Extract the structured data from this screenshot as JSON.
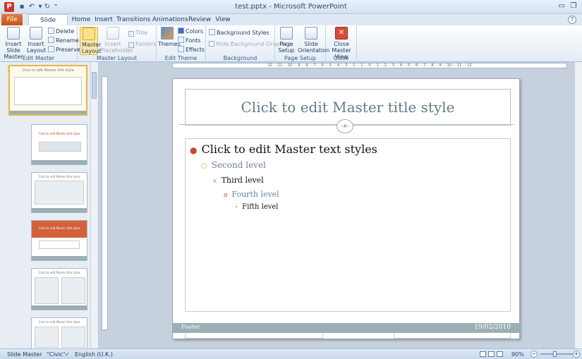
{
  "window": {
    "title": "test.pptx - Microsoft PowerPoint",
    "app_icon_letter": "P",
    "help": "?"
  },
  "tabs": {
    "file": "File",
    "slide_master": "Slide Master",
    "home": "Home",
    "insert": "Insert",
    "transitions": "Transitions",
    "animations": "Animations",
    "review": "Review",
    "view": "View"
  },
  "ribbon": {
    "edit_master": {
      "label": "Edit Master",
      "insert_slide_master": "Insert Slide Master",
      "insert_layout": "Insert Layout",
      "delete": "Delete",
      "rename": "Rename",
      "preserve": "Preserve"
    },
    "master_layout": {
      "label": "Master Layout",
      "master_layout_btn": "Master Layout",
      "insert_placeholder": "Insert Placeholder",
      "title": "Title",
      "footers": "Footers"
    },
    "edit_theme": {
      "label": "Edit Theme",
      "themes": "Themes",
      "colors": "Colors",
      "fonts": "Fonts",
      "effects": "Effects"
    },
    "background": {
      "label": "Background",
      "background_styles": "Background Styles",
      "hide_background_graphics": "Hide Background Graphics"
    },
    "page_setup": {
      "label": "Page Setup",
      "page_setup_btn": "Page Setup",
      "slide_orientation": "Slide Orientation"
    },
    "close": {
      "label": "Close",
      "close_master_view": "Close Master View"
    }
  },
  "thumbnails": {
    "first_number": "1",
    "items": [
      {
        "title": "Click to edit Master title style"
      },
      {
        "title": "Click to edit Master title style"
      },
      {
        "title": "Click to edit Master title style"
      },
      {
        "title": "Click to edit Master title style"
      },
      {
        "title": "Click to edit Master title style"
      },
      {
        "title": "Click to edit Master title style"
      }
    ]
  },
  "ruler": {
    "text": "12 · · 11 · · 10 · · 9 · · 8 · · 7 · · 6 · · 5 · · 4 · · 3 · · 2 · · 1 · · 0 · · 1 · · 2 · · 3 · · 4 · · 5 · · 6 · · 7 · · 8 · · 9 · · 10 · · 11 · · 12"
  },
  "slide": {
    "title": "Click to edit Master title style",
    "emblem": "‹#›",
    "levels": {
      "first": "Click to edit Master text styles",
      "second": "Second level",
      "third": "Third level",
      "fourth": "Fourth level",
      "fifth": "Fifth level"
    },
    "footer": "Footer",
    "date": "19/02/2010"
  },
  "statusbar": {
    "view_mode": "Slide Master",
    "theme": "\"Civic\"",
    "language": "English (U.K.)",
    "zoom": "90%"
  },
  "colors": {
    "file_tab": "#c0561b",
    "footer_band": "#9bb0b4",
    "title_text": "#667a86",
    "level1_bullet": "#c5492a"
  }
}
